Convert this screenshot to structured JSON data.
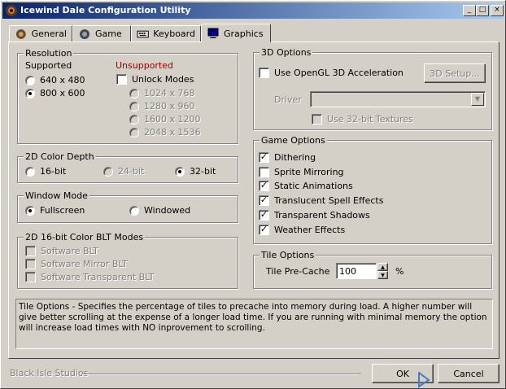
{
  "window": {
    "title": "Icewind Dale Configuration Utility",
    "controls": {
      "minimize": "_",
      "maximize": "□",
      "close": "×"
    }
  },
  "tabs": [
    {
      "label": "General",
      "icon": "general-icon"
    },
    {
      "label": "Game",
      "icon": "game-icon"
    },
    {
      "label": "Keyboard",
      "icon": "keyboard-icon"
    },
    {
      "label": "Graphics",
      "icon": "monitor-icon",
      "active": true
    }
  ],
  "resolution": {
    "legend": "Resolution",
    "supported_label": "Supported",
    "unsupported_label": "Unsupported",
    "supported": [
      {
        "label": "640 x 480",
        "selected": false
      },
      {
        "label": "800 x 600",
        "selected": true
      }
    ],
    "unlock_modes": {
      "label": "Unlock Modes",
      "checked": false
    },
    "unsupported": [
      {
        "label": "1024 x 768"
      },
      {
        "label": "1280 x 960"
      },
      {
        "label": "1600 x 1200"
      },
      {
        "label": "2048 x 1536"
      }
    ]
  },
  "color_depth": {
    "legend": "2D Color Depth",
    "options": [
      {
        "label": "16-bit",
        "selected": false,
        "disabled": false
      },
      {
        "label": "24-bit",
        "selected": false,
        "disabled": true
      },
      {
        "label": "32-bit",
        "selected": true,
        "disabled": false
      }
    ]
  },
  "window_mode": {
    "legend": "Window Mode",
    "options": [
      {
        "label": "Fullscreen",
        "selected": true
      },
      {
        "label": "Windowed",
        "selected": false
      }
    ]
  },
  "blt_modes": {
    "legend": "2D 16-bit Color BLT Modes",
    "options": [
      {
        "label": "Software BLT"
      },
      {
        "label": "Software Mirror BLT"
      },
      {
        "label": "Software Transparent BLT"
      }
    ]
  },
  "options_3d": {
    "legend": "3D Options",
    "opengl": {
      "label": "Use OpenGL 3D Acceleration",
      "checked": false
    },
    "setup_button": "3D Setup...",
    "driver_label": "Driver",
    "driver_value": "",
    "textures": {
      "label": "Use 32-bit Textures",
      "checked": false
    }
  },
  "game_options": {
    "legend": "Game Options",
    "options": [
      {
        "label": "Dithering",
        "checked": true
      },
      {
        "label": "Sprite Mirroring",
        "checked": false
      },
      {
        "label": "Static Animations",
        "checked": true
      },
      {
        "label": "Translucent Spell Effects",
        "checked": true
      },
      {
        "label": "Transparent Shadows",
        "checked": true
      },
      {
        "label": "Weather Effects",
        "checked": true
      }
    ]
  },
  "tile_options": {
    "legend": "Tile Options",
    "label": "Tile Pre-Cache",
    "value": "100",
    "unit": "%"
  },
  "description": "Tile Options - Specifies the percentage of tiles to precache into memory during load.  A higher number will give better scrolling at the expense of a longer load time.  If you are running with minimal memory the option will increase load times with NO inprovement to scrolling.",
  "footer": {
    "company": "Black Isle Studios",
    "ok": "OK",
    "cancel": "Cancel"
  }
}
